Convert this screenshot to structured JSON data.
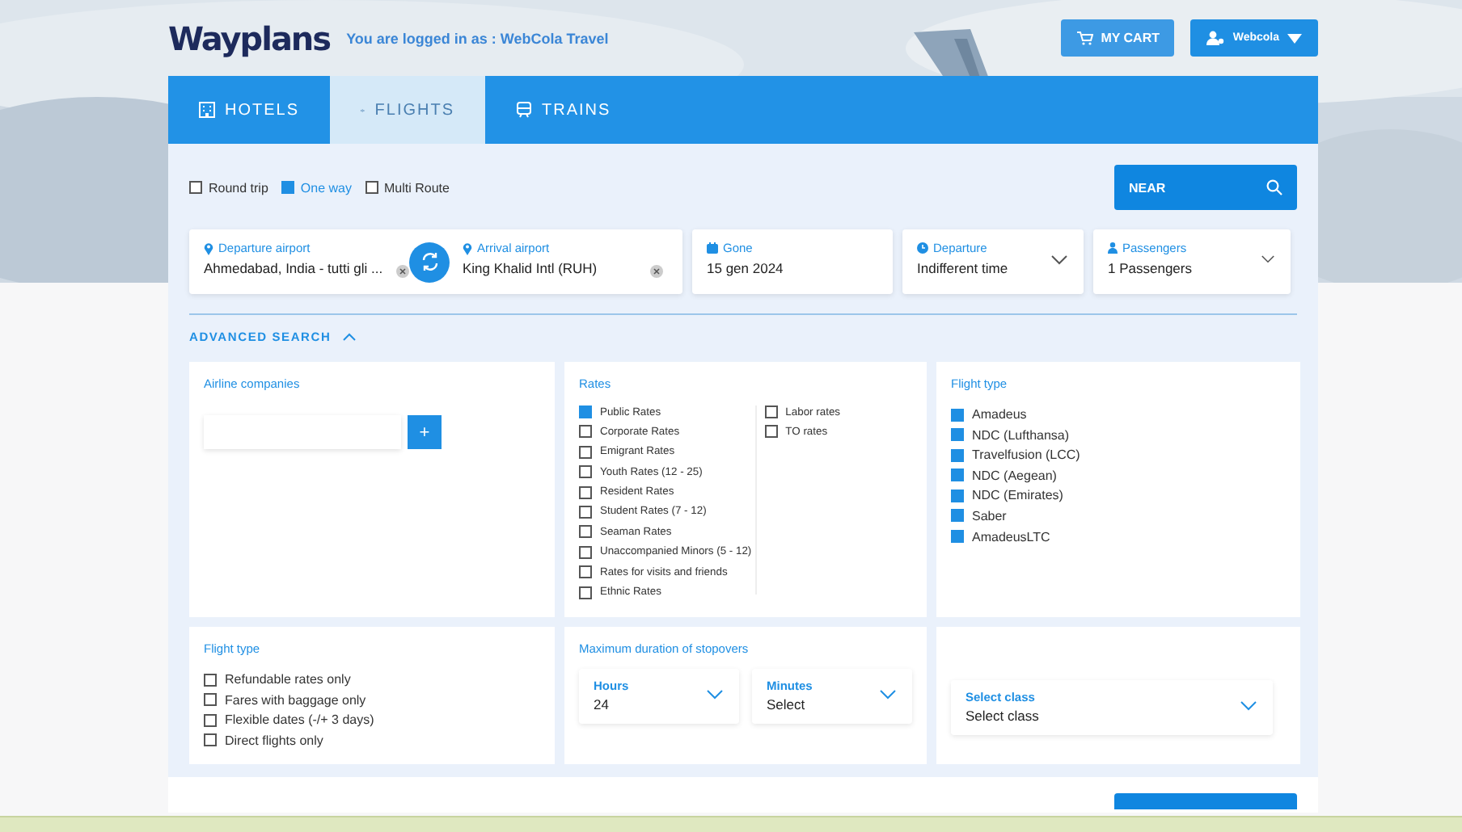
{
  "header": {
    "logo": "Wayplans",
    "login_text": "You are logged in as : WebCola Travel",
    "cart_button": "MY CART",
    "user_button": "Webcola"
  },
  "tabs": [
    {
      "label": "HOTELS",
      "selected": false
    },
    {
      "label": "FLIGHTS",
      "selected": true
    },
    {
      "label": "TRAINS",
      "selected": false
    }
  ],
  "trip_types": [
    {
      "label": "Round trip",
      "selected": false
    },
    {
      "label": "One way",
      "selected": true
    },
    {
      "label": "Multi Route",
      "selected": false
    }
  ],
  "search_button": "NEAR",
  "route": {
    "departure": {
      "label": "Departure airport",
      "value": "Ahmedabad, India - tutti gli ..."
    },
    "arrival": {
      "label": "Arrival airport",
      "value": "King Khalid Intl (RUH)"
    }
  },
  "gone": {
    "label": "Gone",
    "value": "15 gen 2024"
  },
  "departure_time": {
    "label": "Departure",
    "value": "Indifferent time"
  },
  "passengers": {
    "label": "Passengers",
    "value": "1 Passengers"
  },
  "advanced_search": {
    "label": "ADVANCED SEARCH",
    "expanded": true
  },
  "airline_companies": {
    "title": "Airline companies",
    "add_button": "+"
  },
  "rates": {
    "title": "Rates",
    "columns": [
      [
        {
          "label": "Public Rates",
          "checked": true
        },
        {
          "label": "Corporate Rates",
          "checked": false
        },
        {
          "label": "Emigrant Rates",
          "checked": false
        },
        {
          "label": "Youth Rates (12 - 25)",
          "checked": false
        },
        {
          "label": "Resident Rates",
          "checked": false
        },
        {
          "label": "Student Rates (7 - 12)",
          "checked": false
        },
        {
          "label": "Seaman Rates",
          "checked": false
        },
        {
          "label": "Unaccompanied Minors (5 - 12)",
          "checked": false
        },
        {
          "label": "Rates for visits and friends",
          "checked": false
        },
        {
          "label": "Ethnic Rates",
          "checked": false
        }
      ],
      [
        {
          "label": "Labor rates",
          "checked": false
        },
        {
          "label": "TO rates",
          "checked": false
        }
      ]
    ]
  },
  "flight_type": {
    "title": "Flight type",
    "items": [
      {
        "label": "Amadeus",
        "checked": true
      },
      {
        "label": "NDC (Lufthansa)",
        "checked": true
      },
      {
        "label": "Travelfusion (LCC)",
        "checked": true
      },
      {
        "label": "NDC (Aegean)",
        "checked": true
      },
      {
        "label": "NDC (Emirates)",
        "checked": true
      },
      {
        "label": "Saber",
        "checked": true
      },
      {
        "label": "AmadeusLTC",
        "checked": true
      }
    ]
  },
  "options": {
    "title": "Flight type",
    "items": [
      {
        "label": "Refundable rates only",
        "checked": false
      },
      {
        "label": "Fares with baggage only",
        "checked": false
      },
      {
        "label": "Flexible dates (-/+ 3 days)",
        "checked": false
      },
      {
        "label": "Direct flights only",
        "checked": false
      }
    ]
  },
  "stopovers": {
    "title": "Maximum duration of stopovers",
    "selects": [
      {
        "label": "Hours",
        "value": "24"
      },
      {
        "label": "Minutes",
        "value": "Select"
      }
    ]
  },
  "class_select": {
    "label": "Select class",
    "value": "Select class"
  }
}
